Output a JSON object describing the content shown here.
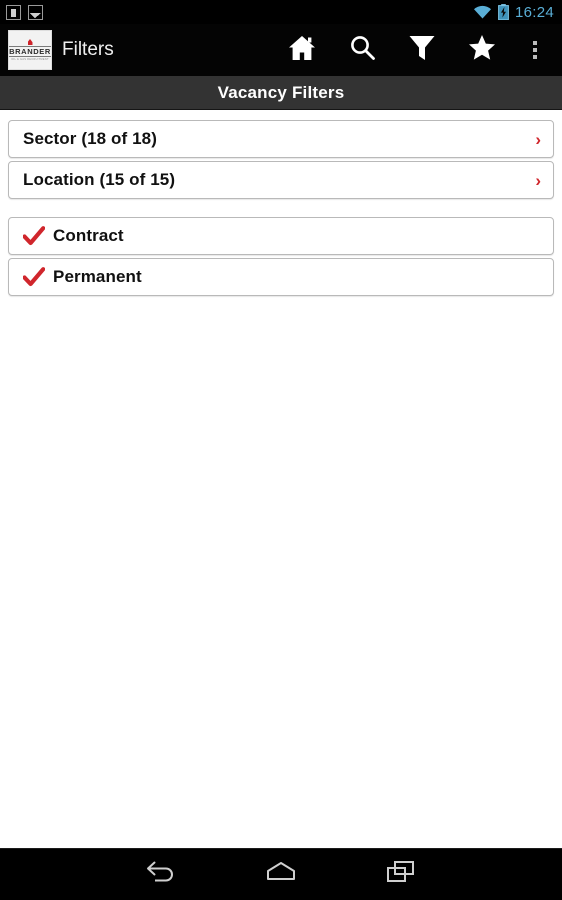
{
  "status_bar": {
    "notifications": [
      "usb-storage-icon",
      "screenshot-icon"
    ],
    "wifi_icon": "wifi-icon",
    "battery_icon": "battery-charging-icon",
    "time": "16:24",
    "accent_color": "#5aaed6"
  },
  "action_bar": {
    "logo": {
      "name": "brander-logo",
      "wordmark": "BRANDER",
      "tagline": "OIL & GAS RECRUITMENT"
    },
    "title": "Filters",
    "actions": [
      {
        "name": "home-icon",
        "label": "Home"
      },
      {
        "name": "search-icon",
        "label": "Search"
      },
      {
        "name": "filter-icon",
        "label": "Filter"
      },
      {
        "name": "star-icon",
        "label": "Favourites"
      },
      {
        "name": "overflow-menu-icon",
        "label": "More options"
      }
    ]
  },
  "sub_header": {
    "title": "Vacancy Filters",
    "background_color": "#333333"
  },
  "filters": {
    "accent_color": "#d0262c",
    "navigation_rows": [
      {
        "label": "Sector (18 of 18)",
        "chevron": "›",
        "selected": 18,
        "total": 18
      },
      {
        "label": "Location (15 of 15)",
        "chevron": "›",
        "selected": 15,
        "total": 15
      }
    ],
    "checkbox_rows": [
      {
        "label": "Contract",
        "checked": true
      },
      {
        "label": "Permanent",
        "checked": true
      }
    ]
  },
  "nav_bar": {
    "buttons": [
      {
        "name": "back-icon",
        "label": "Back"
      },
      {
        "name": "home-icon",
        "label": "Home"
      },
      {
        "name": "recent-apps-icon",
        "label": "Recent apps"
      }
    ]
  }
}
